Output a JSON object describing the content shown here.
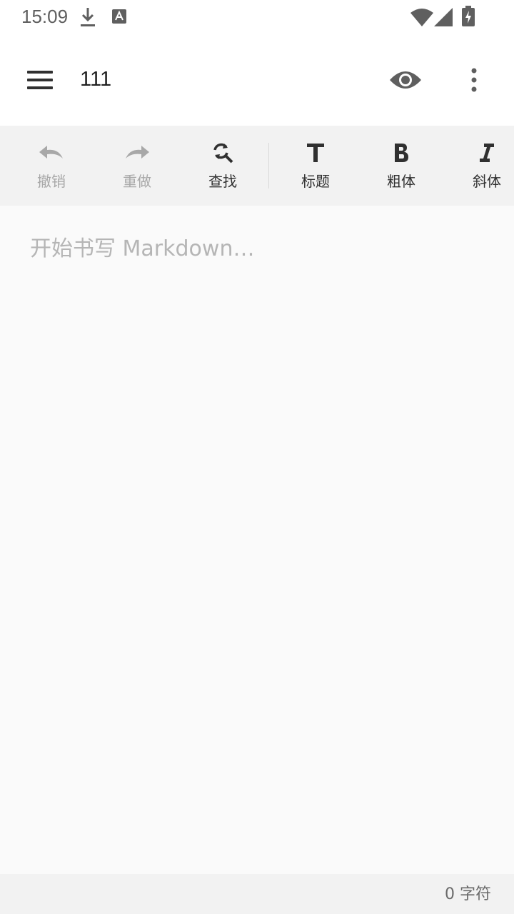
{
  "status_bar": {
    "time": "15:09"
  },
  "app_bar": {
    "title": "111",
    "icons": [
      "menu-icon",
      "eye-icon",
      "more-vert-icon"
    ]
  },
  "toolbar": {
    "items": [
      {
        "label": "撤销",
        "icon": "undo-icon",
        "enabled": false
      },
      {
        "label": "重做",
        "icon": "redo-icon",
        "enabled": false
      },
      {
        "label": "查找",
        "icon": "find-replace-icon",
        "enabled": true
      },
      {
        "label": "标题",
        "icon": "heading-icon",
        "enabled": true
      },
      {
        "label": "粗体",
        "icon": "bold-icon",
        "enabled": true
      },
      {
        "label": "斜体",
        "icon": "italic-icon",
        "enabled": true
      }
    ]
  },
  "editor": {
    "placeholder": "开始书写 Markdown…",
    "value": ""
  },
  "footer": {
    "char_count": "0 字符"
  },
  "colors": {
    "toolbar_bg": "#f2f2f2",
    "editor_bg": "#fafafa",
    "disabled": "#a8a8a8",
    "enabled": "#303030"
  }
}
